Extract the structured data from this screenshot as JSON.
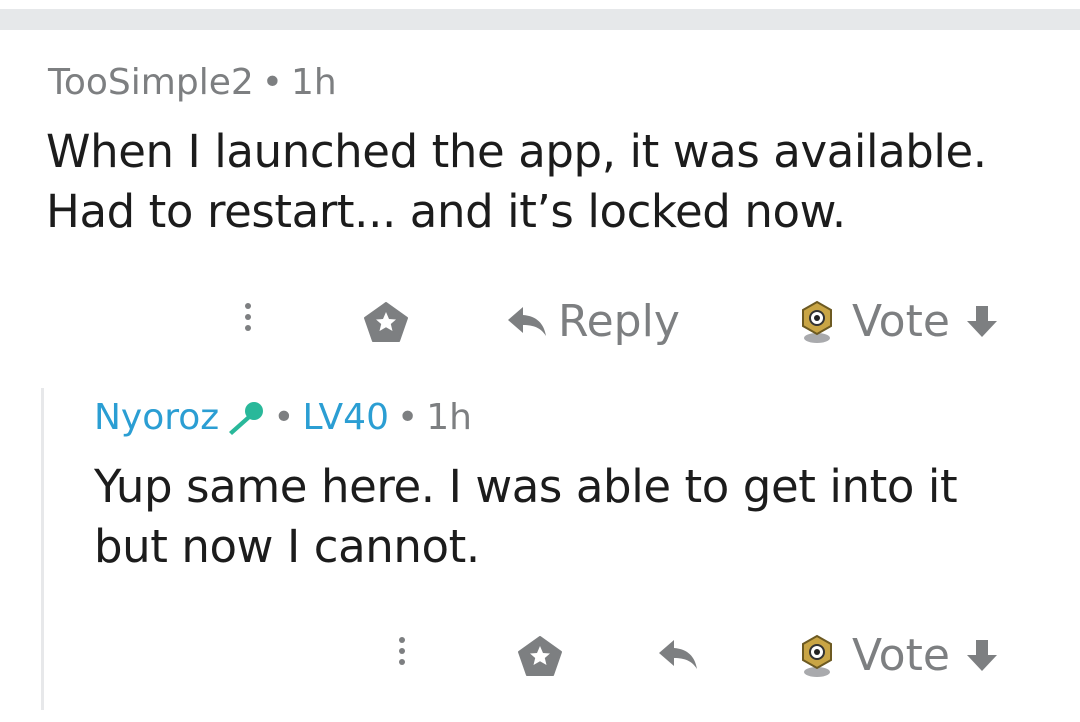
{
  "comments": [
    {
      "username": "TooSimple2",
      "time": "1h",
      "body_line1": "When I launched the app, it was available.",
      "body_line2": "Had to restart... and it’s locked now.",
      "actions": {
        "reply_label": "Reply",
        "vote_label": "Vote"
      }
    },
    {
      "username": "Nyoroz",
      "flair": "LV40",
      "time": "1h",
      "body_line1": "Yup same here. I was able to get into it",
      "body_line2": "but now I cannot.",
      "actions": {
        "vote_label": "Vote"
      }
    }
  ],
  "meta_separator": "•",
  "icons": {
    "more": "more-vertical-icon",
    "award": "award-icon",
    "reply": "reply-arrow-icon",
    "meltan": "meltan-avatar-icon",
    "downvote": "downvote-arrow-icon",
    "flair": "microphone-flair-icon"
  },
  "colors": {
    "meta": "#7d7f81",
    "text": "#1c1c1c",
    "username_highlight": "#2b9ed3",
    "flair_icon": "#29b89a"
  }
}
